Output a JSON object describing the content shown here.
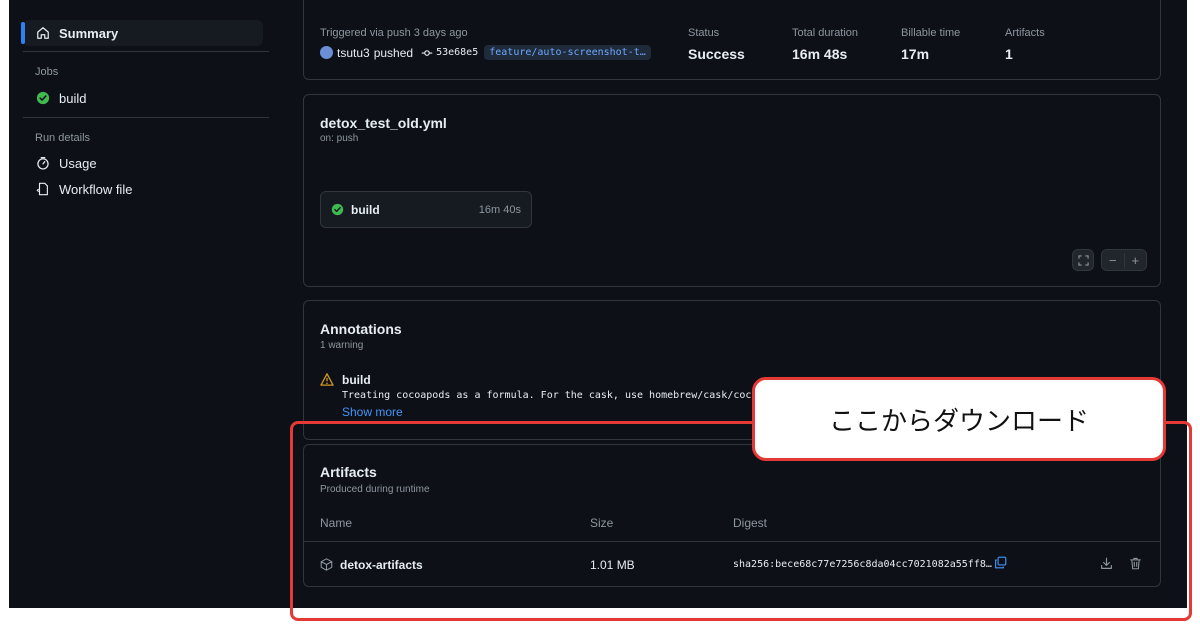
{
  "sidebar": {
    "summary_label": "Summary",
    "jobs_heading": "Jobs",
    "job_build_label": "build",
    "run_details_heading": "Run details",
    "usage_label": "Usage",
    "workflow_file_label": "Workflow file"
  },
  "run_info": {
    "trigger_text": "Triggered via push 3 days ago",
    "user": "tsutu3",
    "action": "pushed",
    "commit": "53e68e5",
    "branch": "feature/auto-screenshot-t…",
    "status_label": "Status",
    "status_value": "Success",
    "duration_label": "Total duration",
    "duration_value": "16m 48s",
    "billable_label": "Billable time",
    "billable_value": "17m",
    "artifacts_label": "Artifacts",
    "artifacts_value": "1"
  },
  "workflow": {
    "filename": "detox_test_old.yml",
    "trigger": "on: push",
    "job_name": "build",
    "job_duration": "16m 40s",
    "zoom_out": "−",
    "zoom_in": "+"
  },
  "annotations": {
    "title": "Annotations",
    "count": "1 warning",
    "warning_job": "build",
    "warning_message": "Treating cocoapods as a formula. For the cask, use homebrew/cask/cocoa",
    "show_more": "Show more"
  },
  "artifacts": {
    "title": "Artifacts",
    "subtitle": "Produced during runtime",
    "col_name": "Name",
    "col_size": "Size",
    "col_digest": "Digest",
    "rows": [
      {
        "name": "detox-artifacts",
        "size": "1.01 MB",
        "digest": "sha256:bece68c77e7256c8da04cc7021082a55ff8…"
      }
    ]
  },
  "callout": {
    "text": "ここからダウンロード"
  },
  "colors": {
    "background": "#0d1117",
    "border": "#30363d",
    "success": "#3fb950",
    "warning": "#d29922",
    "link": "#4493f8",
    "callout_border": "#e53935"
  }
}
